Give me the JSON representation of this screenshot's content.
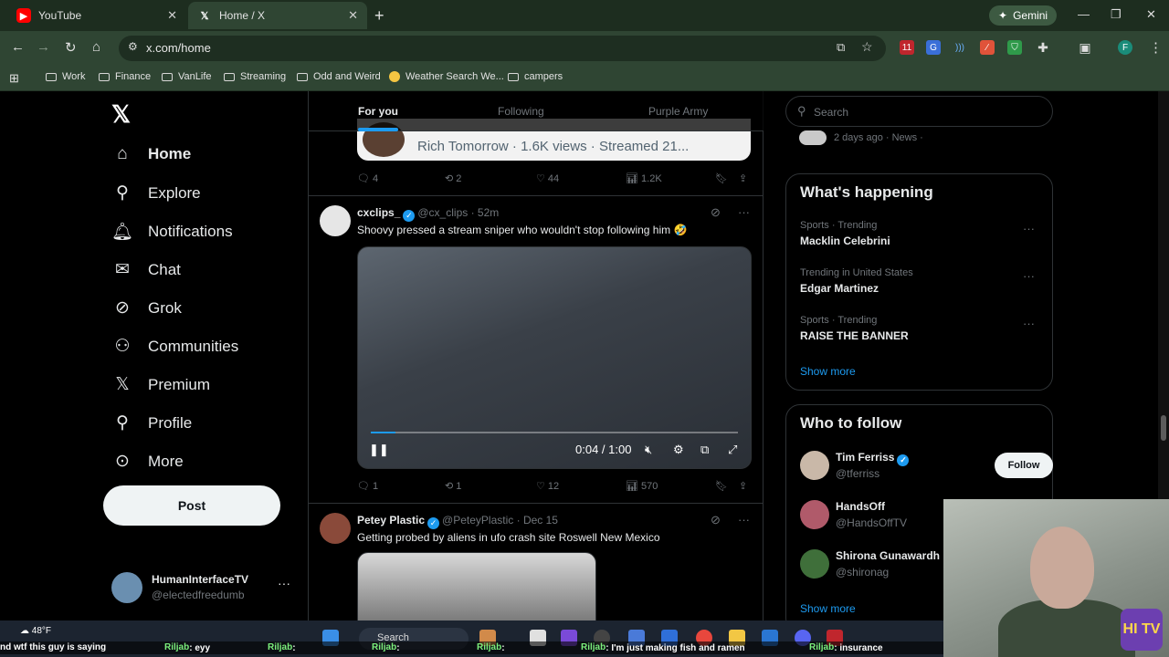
{
  "browser": {
    "tabs": [
      {
        "label": "YouTube",
        "icon": "youtube-icon"
      },
      {
        "label": "Home / X",
        "icon": "x-logo-icon"
      }
    ],
    "gemini_label": "Gemini",
    "url": "x.com/home",
    "bookmarks": [
      "Work",
      "Finance",
      "VanLife",
      "Streaming",
      "Odd and Weird",
      "Weather Search We...",
      "campers"
    ],
    "profile_initial": "F",
    "ext_badge": "11"
  },
  "nav": {
    "items": [
      {
        "label": "Home",
        "icon": "home-icon"
      },
      {
        "label": "Explore",
        "icon": "search-icon"
      },
      {
        "label": "Notifications",
        "icon": "bell-icon"
      },
      {
        "label": "Chat",
        "icon": "mail-icon"
      },
      {
        "label": "Grok",
        "icon": "grok-icon"
      },
      {
        "label": "Communities",
        "icon": "communities-icon"
      },
      {
        "label": "Premium",
        "icon": "x-logo-icon"
      },
      {
        "label": "Profile",
        "icon": "person-icon"
      },
      {
        "label": "More",
        "icon": "more-circle-icon"
      }
    ],
    "post_label": "Post",
    "account": {
      "name": "HumanInterfaceTV",
      "handle": "@electedfreedumb"
    }
  },
  "feed": {
    "tabs": [
      "For you",
      "Following",
      "Purple Army"
    ],
    "quoted_card_text": "Rich Tomorrow  · 1.6K views · Streamed 21...",
    "post0_actions": {
      "replies": "4",
      "reposts": "2",
      "likes": "44",
      "views": "1.2K"
    },
    "post1": {
      "name": "cxclips_",
      "handle": "@cx_clips",
      "time": "· 52m",
      "text": "Shoovy pressed a stream sniper who wouldn't stop following him 🤣",
      "video_time": "0:04 / 1:00",
      "video_progress": 0.067,
      "actions": {
        "replies": "1",
        "reposts": "1",
        "likes": "12",
        "views": "570"
      }
    },
    "post2": {
      "name": "Petey Plastic",
      "handle": "@PeteyPlastic",
      "time": "· Dec 15",
      "text": "Getting probed by aliens in ufo crash site Roswell New Mexico"
    }
  },
  "sidebar": {
    "search_placeholder": "Search",
    "news_meta": "2 days ago · News ·",
    "whats_happening": {
      "title": "What's happening",
      "trends": [
        {
          "meta": "Sports · Trending",
          "name": "Macklin Celebrini"
        },
        {
          "meta": "Trending in United States",
          "name": "Edgar Martinez"
        },
        {
          "meta": "Sports · Trending",
          "name": "RAISE THE BANNER"
        }
      ],
      "show_more": "Show more"
    },
    "who_to_follow": {
      "title": "Who to follow",
      "accounts": [
        {
          "name": "Tim Ferriss",
          "handle": "@tferriss",
          "verified": true
        },
        {
          "name": "HandsOff",
          "handle": "@HandsOffTV",
          "verified": false
        },
        {
          "name": "Shirona Gunawardh",
          "handle": "@shironag",
          "verified": false
        }
      ],
      "follow_label": "Follow",
      "show_more": "Show more"
    }
  },
  "taskbar": {
    "temp": "48°F",
    "search_label": "Search"
  },
  "ticker": {
    "segments": [
      {
        "text": "nd wtf this guy is saying"
      },
      {
        "user": "Riljab",
        "text": ": eyy"
      },
      {
        "user": "Riljab",
        "text": ":"
      },
      {
        "user": "Riljab",
        "text": ":"
      },
      {
        "user": "Riljab",
        "text": ":"
      },
      {
        "user": "Riljab",
        "text": ": I'm just making fish and ramen"
      },
      {
        "user": "Riljab",
        "text": ": insurance"
      }
    ]
  },
  "overlay_logo": "HI TV",
  "colors": {
    "accent": "#1d9bf0",
    "browser_frame": "#2f4533",
    "background": "#000000"
  }
}
